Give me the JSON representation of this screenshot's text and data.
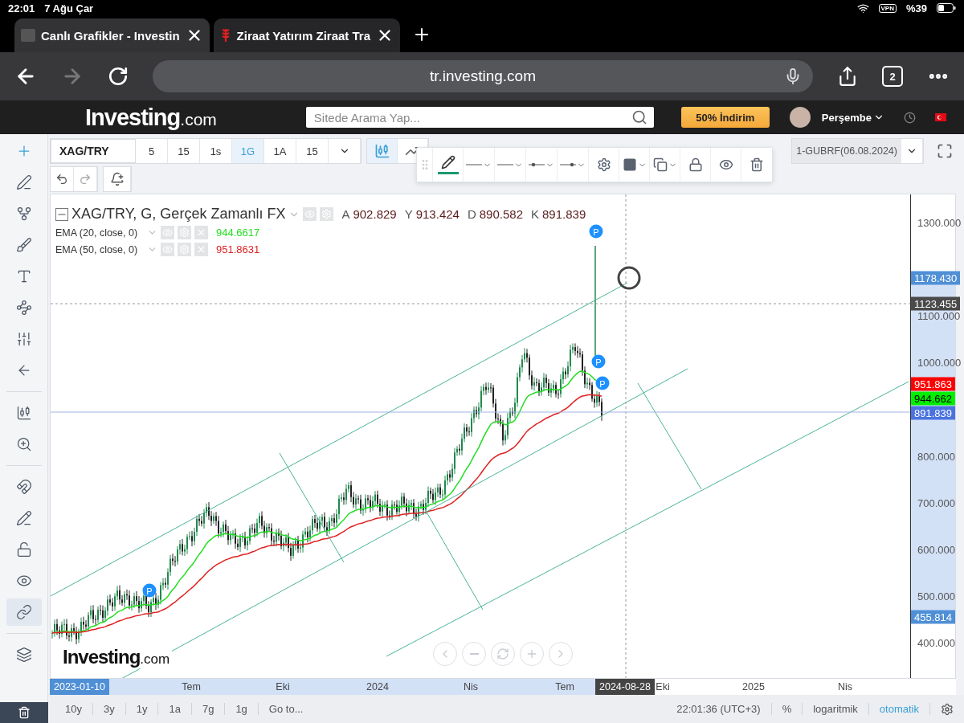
{
  "status_bar": {
    "time": "22:01",
    "date": "7 Ağu Çar",
    "vpn": "VPN",
    "battery": "%39"
  },
  "browser_tabs": [
    {
      "title": "Canlı Grafikler - Investin",
      "selected": true
    },
    {
      "title": "Ziraat Yatırım Ziraat Tra",
      "selected": false
    }
  ],
  "address_bar": {
    "url": "tr.investing.com",
    "tab_count": "2"
  },
  "site_header": {
    "logo": "Investing",
    "logo_suffix": ".com",
    "search_placeholder": "Sitede Arama Yap...",
    "promo": "50% İndirim",
    "user": "Perşembe"
  },
  "chart_toolbar": {
    "symbol": "XAG/TRY",
    "intervals": [
      {
        "label": "5",
        "selected": false
      },
      {
        "label": "15",
        "selected": false
      },
      {
        "label": "1s",
        "selected": false
      },
      {
        "label": "1G",
        "selected": true
      },
      {
        "label": "1A",
        "selected": false
      },
      {
        "label": "15",
        "selected": false
      }
    ],
    "compare": "1-GUBRF(06.08.2024)"
  },
  "legend": {
    "title": "XAG/TRY, G, Gerçek Zamanlı FX",
    "ohlc": [
      {
        "key": "A",
        "value": "902.829"
      },
      {
        "key": "Y",
        "value": "913.424"
      },
      {
        "key": "D",
        "value": "890.582"
      },
      {
        "key": "K",
        "value": "891.839"
      }
    ],
    "indicators": [
      {
        "name": "EMA (20, close, 0)",
        "value": "944.6617",
        "color": "#22dd22"
      },
      {
        "name": "EMA (50, close, 0)",
        "value": "951.8631",
        "color": "#e02020"
      }
    ]
  },
  "markers": [
    {
      "label": "P"
    },
    {
      "label": "P"
    },
    {
      "label": "P"
    },
    {
      "label": "P"
    }
  ],
  "chart_logo": {
    "text": "Investing",
    "suffix": ".com"
  },
  "left_toolbar": {
    "tools": [
      {
        "selected": false
      },
      {
        "selected": false
      },
      {
        "selected": false
      },
      {
        "selected": false
      },
      {
        "selected": false
      },
      {
        "selected": false
      },
      {
        "selected": false
      },
      {
        "selected": false
      },
      {
        "selected": false
      },
      {
        "selected": false
      },
      {
        "selected": false
      },
      {
        "selected": false
      },
      {
        "selected": false
      },
      {
        "selected": false
      },
      {
        "selected": true
      },
      {
        "selected": false
      }
    ]
  },
  "chart_types": [
    {
      "selected": true
    },
    {
      "selected": false
    }
  ],
  "price_axis": {
    "ticks": [
      "1300.000",
      "1100.000",
      "1000.000",
      "800.000",
      "700.000",
      "600.000",
      "500.000",
      "400.000"
    ],
    "tags": [
      {
        "value": "1178.430",
        "color": "#4f8fd6"
      },
      {
        "value": "1123.455",
        "color": "#4a4a4a"
      },
      {
        "value": "951.863",
        "color": "#ff0000"
      },
      {
        "value": "944.662",
        "color": "#00ee00"
      },
      {
        "value": "891.839",
        "color": "#4a72e0"
      },
      {
        "value": "455.814",
        "color": "#4f8fd6"
      }
    ]
  },
  "time_axis": {
    "start_tag": "2023-01-10",
    "labels": [
      "Tem",
      "Eki",
      "2024",
      "Nis",
      "Tem",
      "Eki",
      "2025",
      "Nis"
    ],
    "cursor_tag": "2024-08-28"
  },
  "bottom_bar": {
    "ranges": [
      "10y",
      "3y",
      "1y",
      "1a",
      "7g",
      "1g"
    ],
    "goto": "Go to...",
    "clock": "22:01:36 (UTC+3)",
    "options": [
      {
        "label": "%",
        "selected": false
      },
      {
        "label": "logaritmik",
        "selected": false
      },
      {
        "label": "otomatik",
        "selected": true
      }
    ]
  }
}
